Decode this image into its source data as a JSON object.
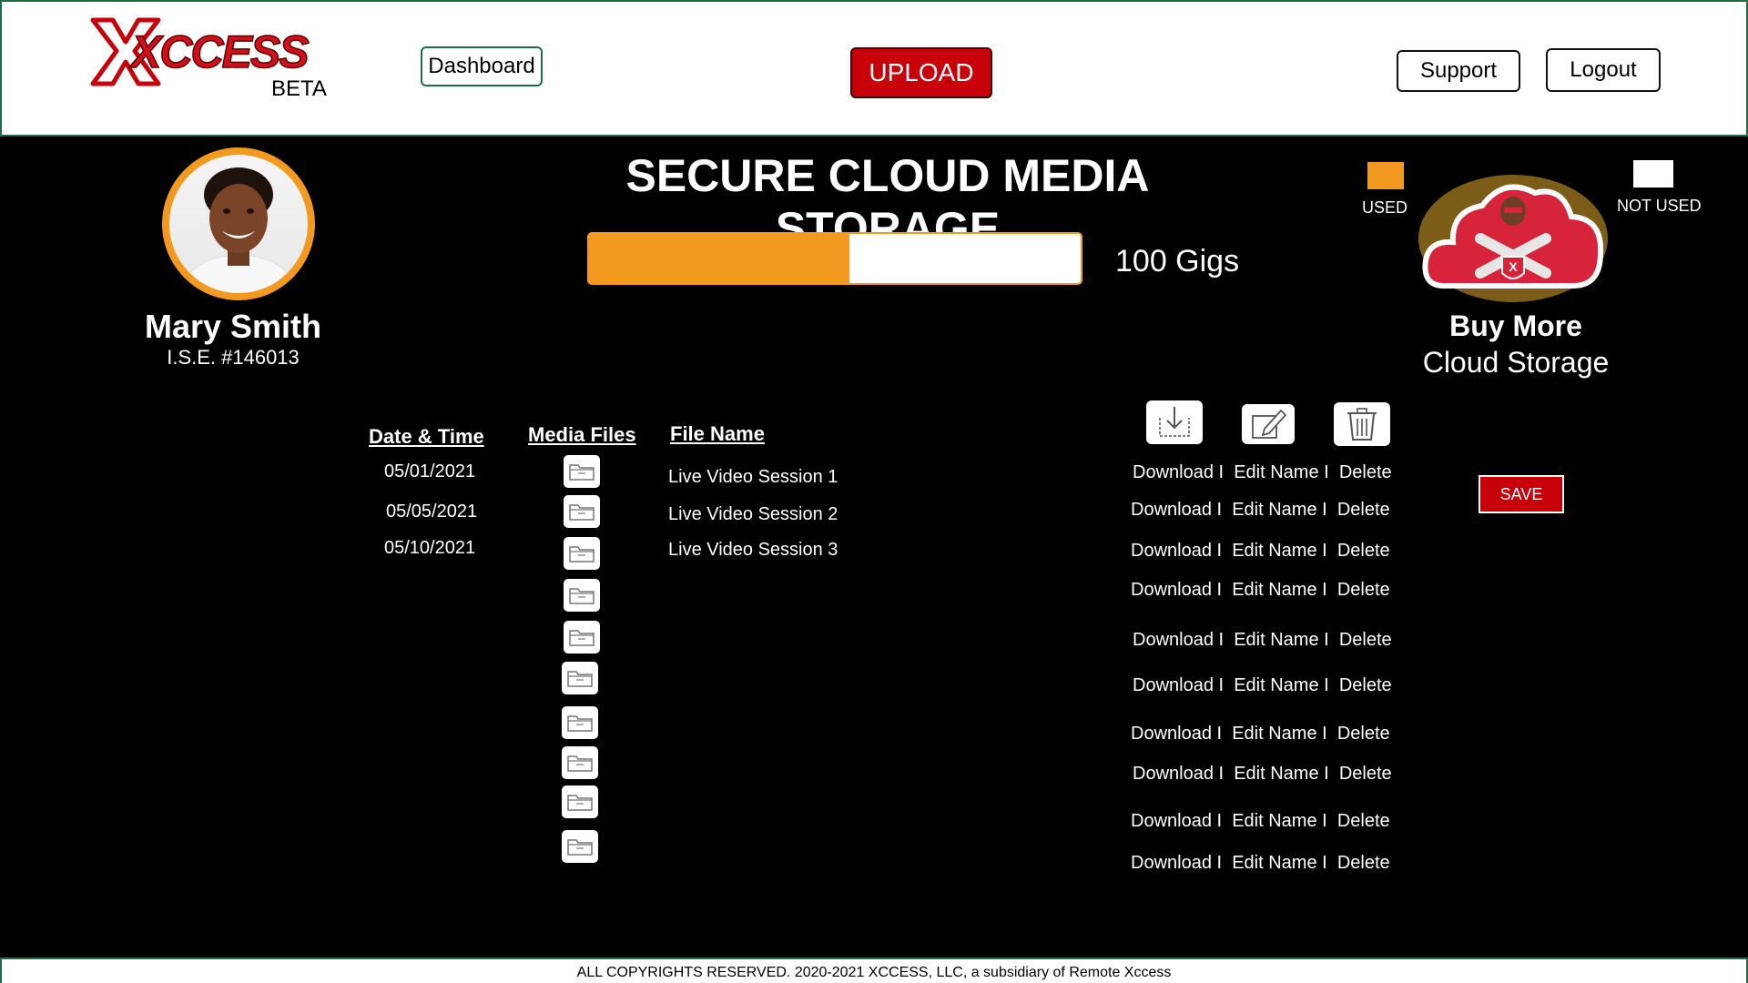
{
  "header": {
    "logo_text": "XCCESS",
    "logo_sub": "BETA",
    "dashboard_label": "Dashboard",
    "upload_label": "UPLOAD",
    "support_label": "Support",
    "logout_label": "Logout"
  },
  "profile": {
    "name": "Mary Smith",
    "id": "I.S.E. #146013"
  },
  "storage": {
    "title": "SECURE CLOUD MEDIA STORAGE",
    "used_fraction": 0.53,
    "total_label": "100 Gigs",
    "legend_used": "USED",
    "legend_not_used": "NOT USED",
    "used_color": "#f29a1f",
    "not_used_color": "#ffffff"
  },
  "buy_more": {
    "title": "Buy More",
    "subtitle": "Cloud Storage"
  },
  "table": {
    "headers": {
      "date": "Date & Time",
      "media": "Media Files",
      "file": "File Name"
    },
    "rows": [
      {
        "date": "05/01/2021",
        "file": "Live Video Session 1"
      },
      {
        "date": "05/05/2021",
        "file": "Live Video Session 2"
      },
      {
        "date": "05/10/2021",
        "file": "Live Video Session 3"
      },
      {
        "date": "",
        "file": ""
      },
      {
        "date": "",
        "file": ""
      },
      {
        "date": "",
        "file": ""
      },
      {
        "date": "",
        "file": ""
      },
      {
        "date": "",
        "file": ""
      },
      {
        "date": "",
        "file": ""
      },
      {
        "date": "",
        "file": ""
      }
    ]
  },
  "actions": {
    "download": "Download",
    "edit": "Edit Name",
    "delete": "Delete",
    "separator": "I",
    "icons": [
      "download-icon",
      "edit-icon",
      "trash-icon"
    ]
  },
  "save_label": "SAVE",
  "footer": {
    "text": "ALL COPYRIGHTS RESERVED.  2020-2021 XCCESS, LLC, a subsidiary of Remote Xccess"
  },
  "colors": {
    "brand_red": "#c8000a",
    "accent_orange": "#f29a1f",
    "header_border": "#1f6b45"
  }
}
